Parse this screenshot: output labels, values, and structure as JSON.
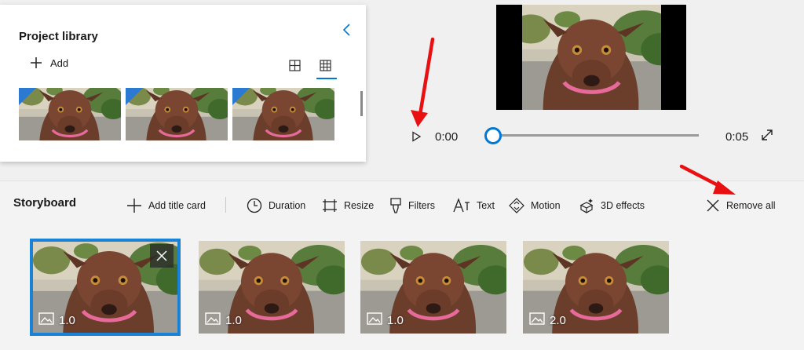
{
  "library": {
    "title": "Project library",
    "add_label": "Add",
    "thumbnails": [
      "dog-photo-1",
      "dog-photo-2",
      "dog-photo-3"
    ]
  },
  "player": {
    "current_time": "0:00",
    "duration": "0:05",
    "progress": 0
  },
  "storyboard": {
    "title": "Storyboard",
    "tools": {
      "add_title_card": "Add title card",
      "duration": "Duration",
      "resize": "Resize",
      "filters": "Filters",
      "text": "Text",
      "motion": "Motion",
      "effects_3d": "3D effects",
      "remove_all": "Remove all"
    },
    "clips": [
      {
        "duration": "1.0",
        "selected": true
      },
      {
        "duration": "1.0",
        "selected": false
      },
      {
        "duration": "1.0",
        "selected": false
      },
      {
        "duration": "2.0",
        "selected": false
      }
    ]
  },
  "colors": {
    "accent": "#0078d4",
    "annotation_arrow": "#e81010"
  },
  "icons": [
    "chevron-left-icon",
    "plus-icon",
    "grid-large-icon",
    "grid-small-icon",
    "play-icon",
    "fullscreen-icon",
    "clock-icon",
    "resize-icon",
    "filters-icon",
    "text-icon",
    "motion-icon",
    "3d-effects-icon",
    "close-icon",
    "image-icon"
  ]
}
